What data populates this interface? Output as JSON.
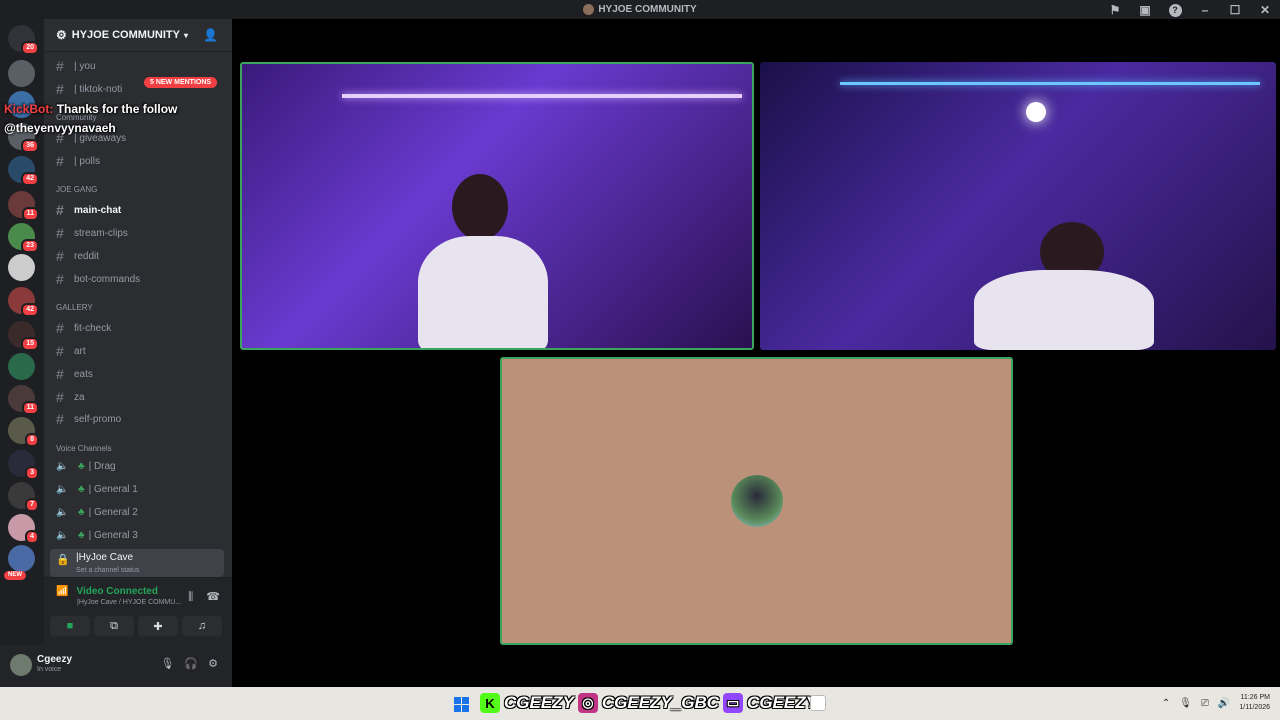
{
  "window": {
    "title": "HYJOE COMMUNITY"
  },
  "server": {
    "name": "HYJOE COMMUNITY",
    "new_mentions": "5 NEW MENTIONS"
  },
  "server_badges": [
    {
      "label": "20"
    },
    {
      "label": ""
    },
    {
      "label": ""
    },
    {
      "label": "36"
    },
    {
      "label": "42"
    },
    {
      "label": "11"
    },
    {
      "label": "23"
    },
    {
      "label": ""
    },
    {
      "label": "42"
    },
    {
      "label": "15"
    },
    {
      "label": ""
    },
    {
      "label": "11"
    },
    {
      "label": "8"
    },
    {
      "label": "3"
    },
    {
      "label": "7"
    },
    {
      "label": "4"
    },
    {
      "label": "NEW"
    }
  ],
  "channels": {
    "top": [
      {
        "name": "| you"
      },
      {
        "name": "| tiktok-noti"
      }
    ],
    "community_label": "Community",
    "community": [
      {
        "name": "| giveaways"
      },
      {
        "name": "| polls"
      }
    ],
    "joe_gang_label": "JOE GANG",
    "joe_gang": [
      {
        "name": "main-chat"
      },
      {
        "name": "stream-clips"
      },
      {
        "name": "reddit"
      },
      {
        "name": "bot-commands"
      }
    ],
    "gallery_label": "GALLERY",
    "gallery": [
      {
        "name": "fit-check"
      },
      {
        "name": "art"
      },
      {
        "name": "eats"
      },
      {
        "name": "za"
      },
      {
        "name": "self-promo"
      }
    ],
    "voice_label": "Voice Channels",
    "voice": [
      {
        "name": "| Drag"
      },
      {
        "name": "| General 1"
      },
      {
        "name": "| General 2"
      },
      {
        "name": "| General 3"
      }
    ],
    "cave": {
      "name": "|HyJoe Cave",
      "status": "Set a channel status"
    }
  },
  "voice_panel": {
    "connected": "Video Connected",
    "location": "|HyJoe Cave / HYJOE COMMU..."
  },
  "user": {
    "name": "Cgeezy",
    "status": "In voice"
  },
  "overlay": {
    "bot": "KickBot:",
    "message": "Thanks for the follow",
    "handle": "@theyenvyynavaeh"
  },
  "banner": {
    "kick": "CGEEZY",
    "instagram": "CGEEZY_GBC",
    "twitch": "CGEEZY"
  },
  "clock": {
    "time": "11:26 PM",
    "date": "1/11/2026"
  },
  "colors": {
    "accent": "#3ba55d",
    "mention": "#f23f43",
    "tile_bg": "#bc917a"
  }
}
